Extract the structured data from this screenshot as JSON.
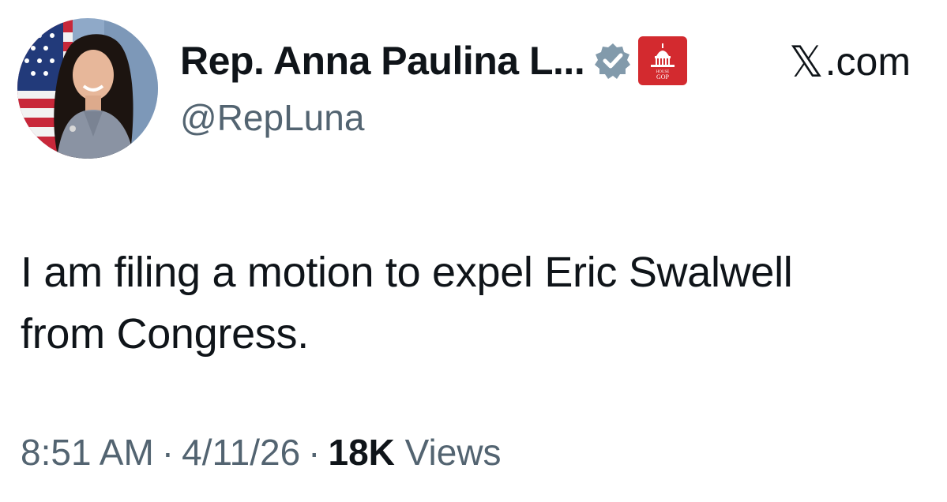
{
  "author": {
    "display_name": "Rep. Anna Paulina L...",
    "handle": "@RepLuna",
    "verified_badge": "verified-badge-icon",
    "affiliation_badge": {
      "label_top": "HOUSE",
      "label_bottom": "GOP",
      "color": "#d32a2f"
    }
  },
  "source": {
    "logo": "𝕏",
    "label": ".com"
  },
  "tweet": {
    "text_line1": "I am filing a motion to expel Eric Swalwell",
    "text_line2": "from Congress."
  },
  "meta": {
    "time": "8:51 AM",
    "date": "4/11/26",
    "separator": "·",
    "views_count": "18K",
    "views_label": "Views"
  },
  "colors": {
    "text_primary": "#0f1419",
    "text_secondary": "#536471",
    "verified_gray": "#829aab"
  }
}
